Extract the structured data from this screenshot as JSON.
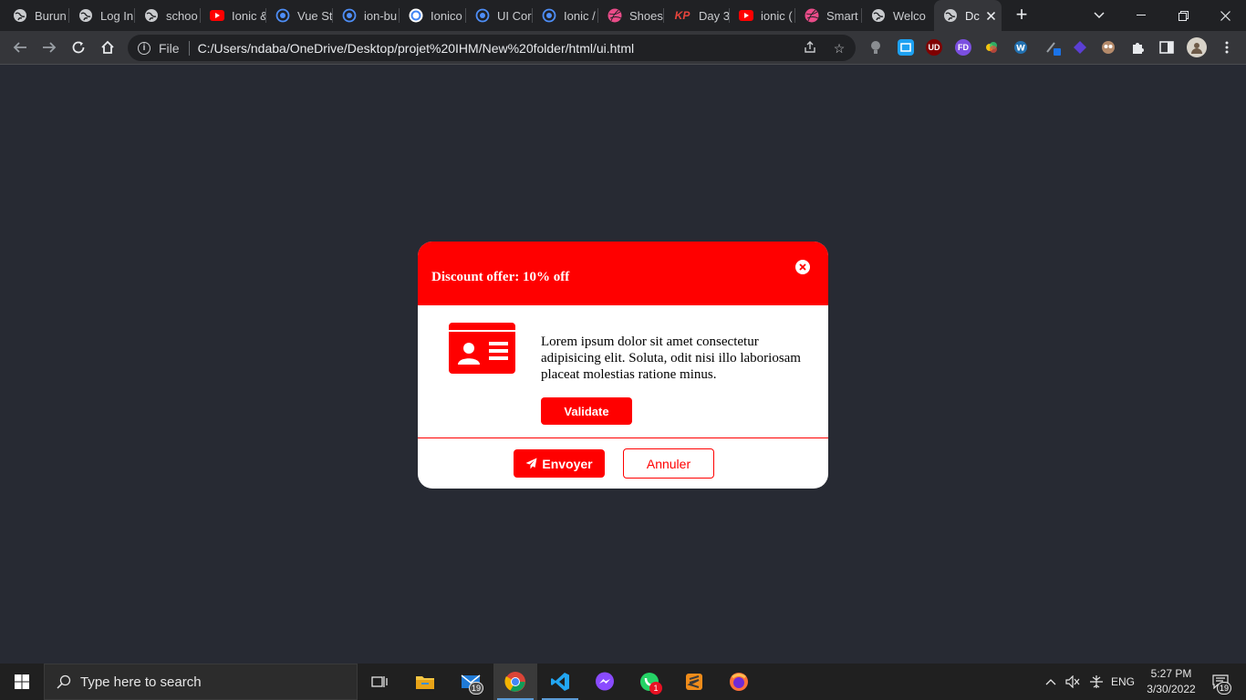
{
  "browser": {
    "tabs": [
      {
        "title": "Burun",
        "icon": "globe-icon"
      },
      {
        "title": "Log In",
        "icon": "globe-icon"
      },
      {
        "title": "schoo",
        "icon": "globe-icon"
      },
      {
        "title": "Ionic &",
        "icon": "youtube-icon"
      },
      {
        "title": "Vue St",
        "icon": "ionic-icon"
      },
      {
        "title": "ion-bu",
        "icon": "ionic-icon"
      },
      {
        "title": "Ionico",
        "icon": "google-icon"
      },
      {
        "title": "UI Cor",
        "icon": "ionic-icon"
      },
      {
        "title": "Ionic /",
        "icon": "ionic-icon"
      },
      {
        "title": "Shoes",
        "icon": "dribbble-icon"
      },
      {
        "title": "Day 3",
        "icon": "kp-icon"
      },
      {
        "title": "ionic (",
        "icon": "youtube-icon"
      },
      {
        "title": "Smart",
        "icon": "dribbble-icon"
      },
      {
        "title": "Welco",
        "icon": "globe-icon"
      },
      {
        "title": "Dc",
        "icon": "globe-icon",
        "active": true
      }
    ],
    "kp_label": "KP",
    "address": {
      "scheme_label": "File",
      "url": "C:/Users/ndaba/OneDrive/Desktop/projet%20IHM/New%20folder/html/ui.html"
    },
    "ext_labels": {
      "ublock": "UD",
      "fd": "FD"
    },
    "colors": {
      "tabstrip": "#202124",
      "toolbar": "#35363a",
      "page": "#272a33"
    }
  },
  "modal": {
    "title": "Discount offer: 10% off",
    "body": "Lorem ipsum dolor sit amet consectetur adipisicing elit. Soluta, odit nisi illo laboriosam placeat molestias ratione minus.",
    "validate_label": "Validate",
    "send_label": "Envoyer",
    "cancel_label": "Annuler",
    "accent": "#ff0000"
  },
  "taskbar": {
    "search_placeholder": "Type here to search",
    "mail_badge": "19",
    "whatsapp_badge": "1",
    "language": "ENG",
    "time": "5:27 PM",
    "date": "3/30/2022",
    "notification_count": "19"
  }
}
